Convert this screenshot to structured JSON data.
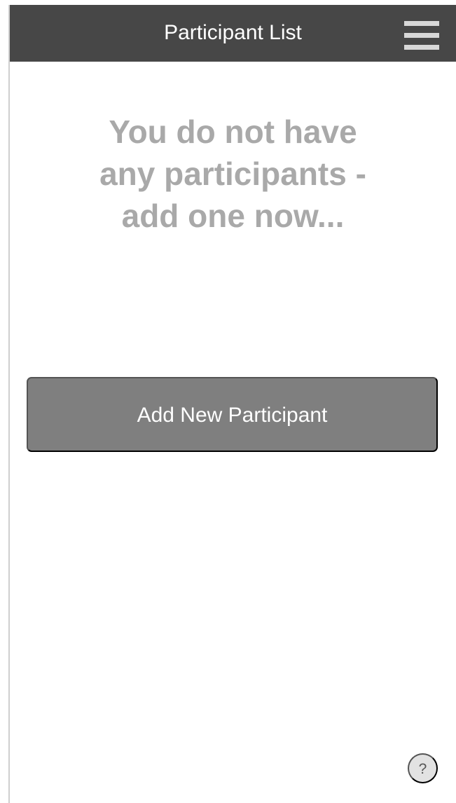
{
  "header": {
    "title": "Participant List",
    "menu_icon": "hamburger-menu-icon"
  },
  "main": {
    "empty_message": "You do not have any participants - add one now...",
    "add_button_label": "Add New Participant"
  },
  "footer": {
    "help_label": "?",
    "help_icon": "question-icon"
  },
  "colors": {
    "header_background": "#474747",
    "header_text": "#ffffff",
    "menu_bars": "#d8d8d8",
    "empty_message_text": "#a9a9a9",
    "add_button_background": "#7f7f7f",
    "add_button_text": "#ffffff",
    "help_button_background": "#e2e2e2",
    "help_button_text": "#555555",
    "left_border": "#cfcfcf"
  }
}
